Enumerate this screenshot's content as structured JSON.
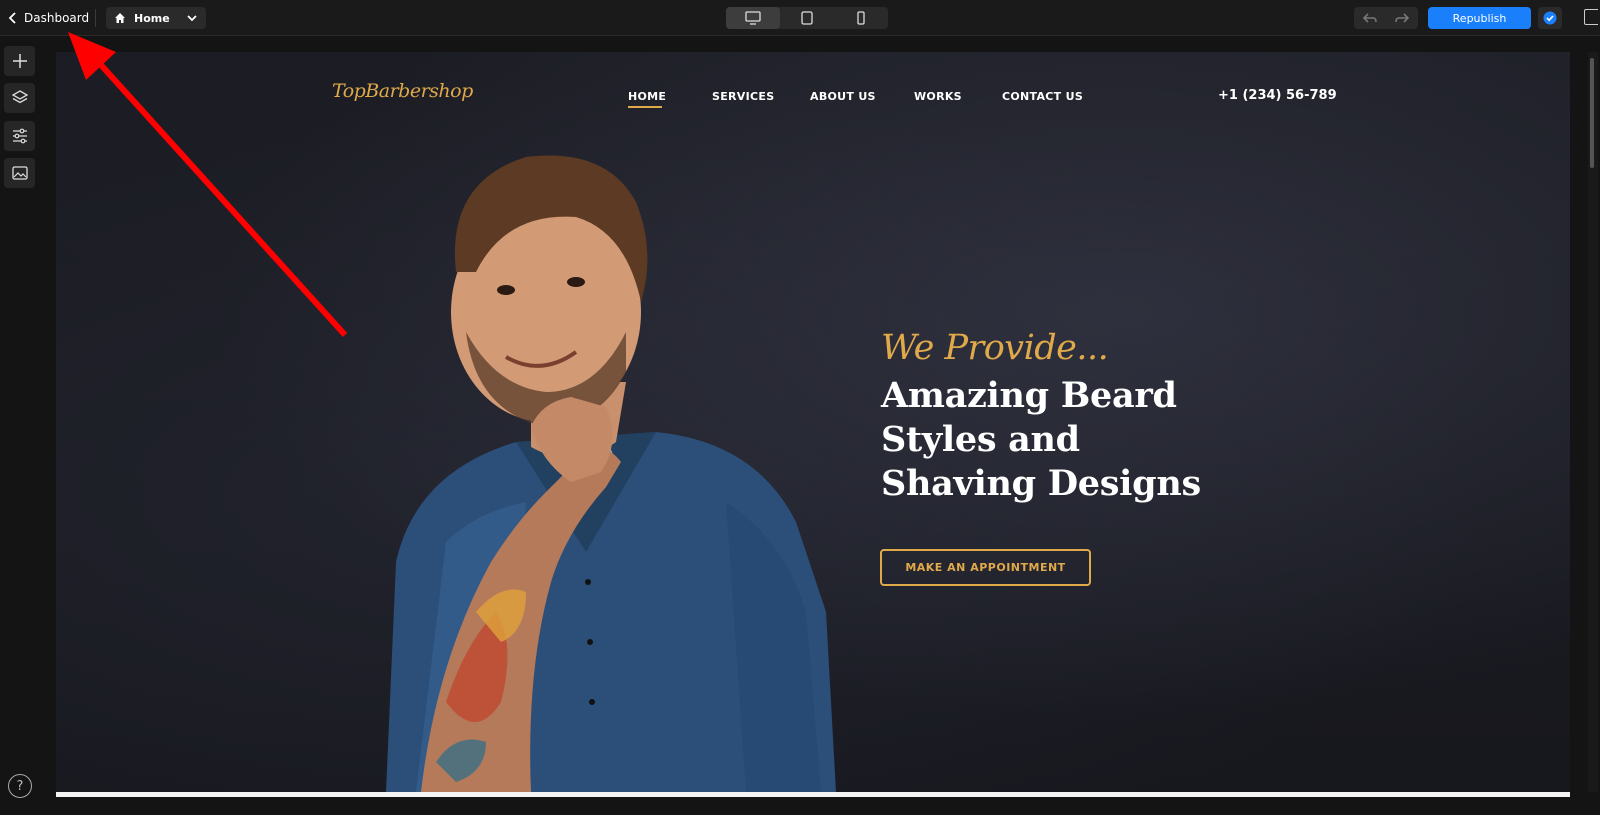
{
  "editor": {
    "back_label": "Dashboard",
    "page_select": "Home",
    "publish_label": "Republish",
    "colors": {
      "accent": "#1a7ffb",
      "toolbar": "#1a1a1a"
    },
    "devices": [
      {
        "icon": "desktop-icon",
        "active": true
      },
      {
        "icon": "tablet-icon",
        "active": false
      },
      {
        "icon": "mobile-icon",
        "active": false
      }
    ],
    "left_tools": [
      "plus-icon",
      "layers-icon",
      "sliders-icon",
      "image-icon"
    ],
    "help_label": "?"
  },
  "site": {
    "logo": "TopBarbershop",
    "nav": [
      "HOME",
      "SERVICES",
      "ABOUT US",
      "WORKS",
      "CONTACT US"
    ],
    "active_nav": "HOME",
    "phone": "+1 (234) 56-789",
    "tagline": "We Provide...",
    "headline": [
      "Amazing Beard",
      "Styles and",
      "Shaving Designs"
    ],
    "cta": "MAKE AN APPOINTMENT",
    "colors": {
      "gold": "#e0a94a",
      "background": "#1c1d24"
    }
  },
  "annotation": {
    "arrow_color": "#ff0000"
  }
}
